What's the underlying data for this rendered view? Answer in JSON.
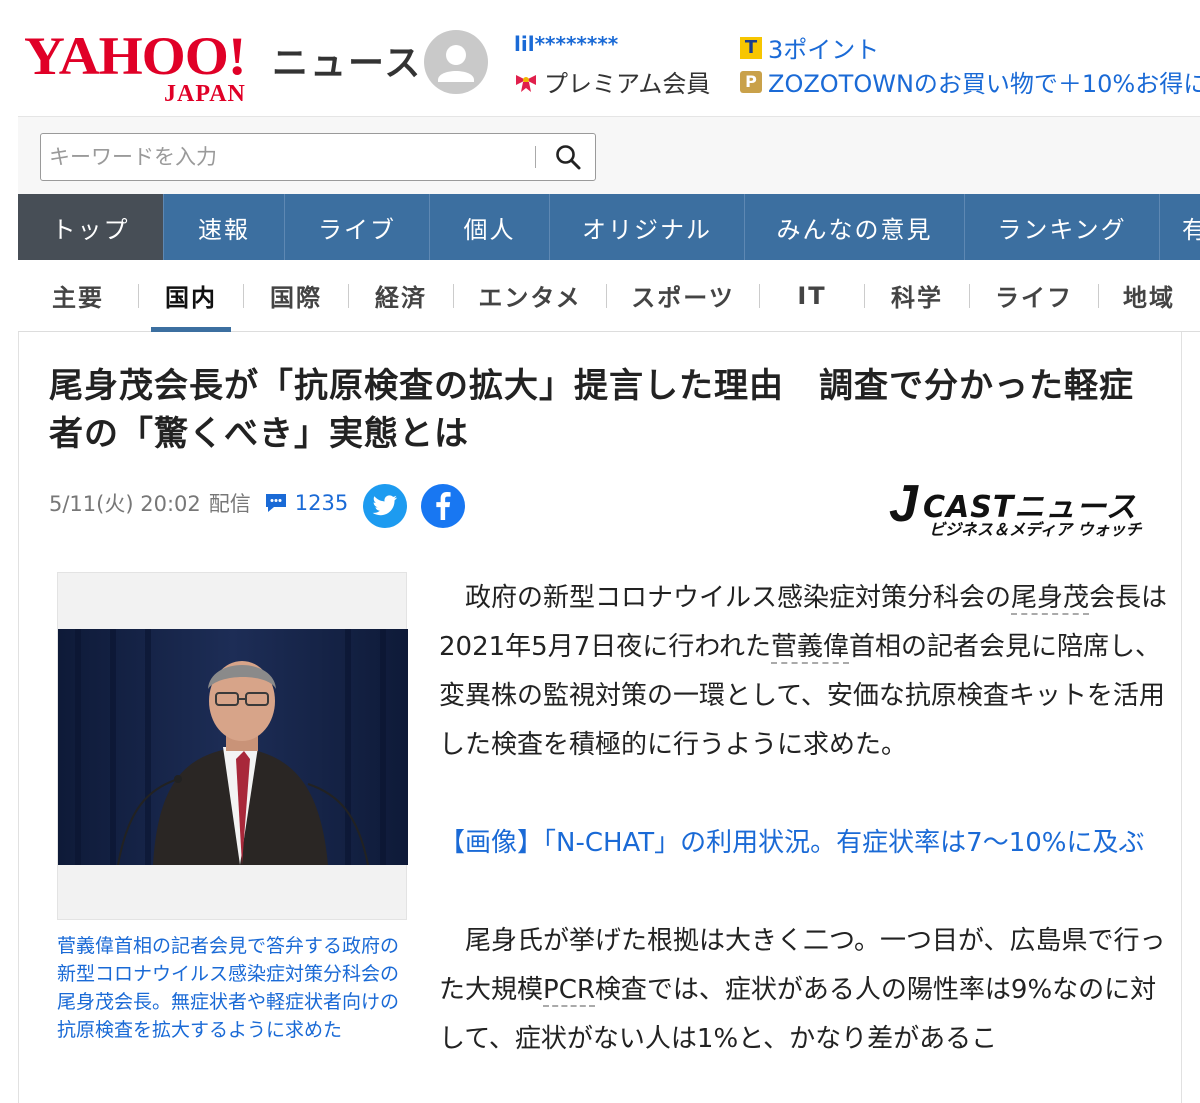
{
  "header": {
    "logo_main": "YAHOO!",
    "logo_sub": "JAPAN",
    "section_title": "ニュース",
    "username": "lil********",
    "membership": "プレミアム会員",
    "points": "3ポイント",
    "zozo_promo": "ZOZOTOWNのお買い物で＋10%お得に"
  },
  "search": {
    "placeholder": "キーワードを入力"
  },
  "main_nav": [
    {
      "label": "トップ"
    },
    {
      "label": "速報"
    },
    {
      "label": "ライブ"
    },
    {
      "label": "個人"
    },
    {
      "label": "オリジナル"
    },
    {
      "label": "みんなの意見"
    },
    {
      "label": "ランキング"
    },
    {
      "label": "有"
    }
  ],
  "sub_nav": [
    {
      "label": "主要"
    },
    {
      "label": "国内"
    },
    {
      "label": "国際"
    },
    {
      "label": "経済"
    },
    {
      "label": "エンタメ"
    },
    {
      "label": "スポーツ"
    },
    {
      "label": "IT"
    },
    {
      "label": "科学"
    },
    {
      "label": "ライフ"
    },
    {
      "label": "地域"
    }
  ],
  "article": {
    "headline": "尾身茂会長が「抗原検査の拡大」提言した理由　調査で分かった軽症者の「驚くべき」実態とは",
    "date": "5/11(火) 20:02",
    "delivered": "配信",
    "comment_count": "1235",
    "source_main": "CASTニュース",
    "source_j": "J",
    "source_sub": "ビジネス＆メディア ウォッチ",
    "caption": "菅義偉首相の記者会見で答弁する政府の新型コロナウイルス感染症対策分科会の尾身茂会長。無症状者や軽症状者向けの抗原検査を拡大するように求めた",
    "p1_a": "政府の新型コロナウイルス感染症対策分科会の",
    "p1_name": "尾身茂",
    "p1_b": "会長は2021年5月7日夜に行われた",
    "p1_name2": "菅義偉",
    "p1_c": "首相の記者会見に陪席し、変異株の監視対策の一環として、安価な抗原検査キットを活用した検査を積極的に行うように求めた。",
    "link": "【画像】「N-CHAT」の利用状況。有症状率は7〜10%に及ぶ",
    "p2_a": "尾身氏が挙げた根拠は大きく二つ。一つ目が、広島県で行った大規模",
    "p2_pcr": "PCR",
    "p2_b": "検査では、症状がある人の陽性率は9%なのに対して、症状がない人は1%と、かなり差があるこ"
  }
}
